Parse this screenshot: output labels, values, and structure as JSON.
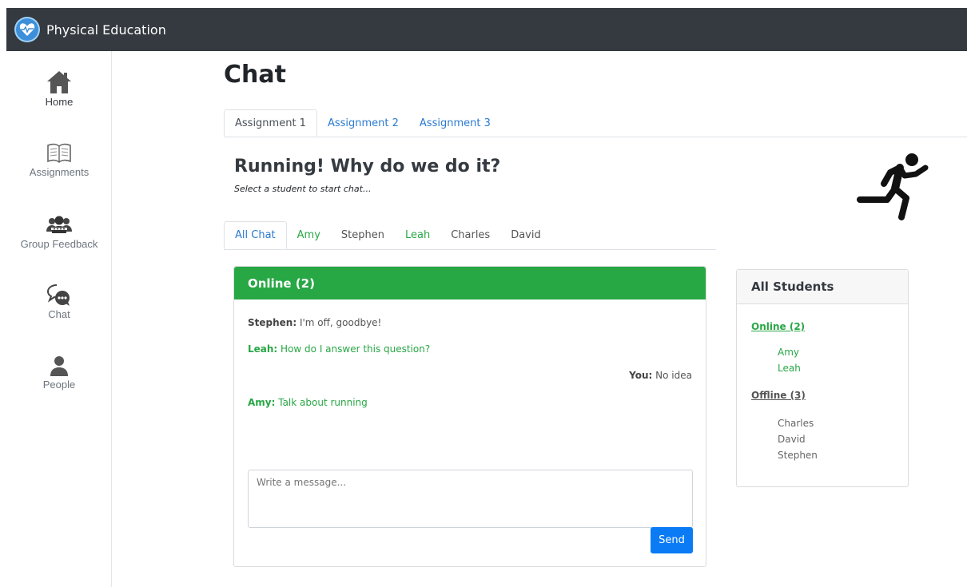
{
  "app": {
    "title": "Physical Education"
  },
  "sidebar": {
    "items": [
      {
        "label": "Home",
        "icon": "home-icon"
      },
      {
        "label": "Assignments",
        "icon": "book-icon"
      },
      {
        "label": "Group Feedback",
        "icon": "group-icon"
      },
      {
        "label": "Chat",
        "icon": "chat-icon"
      },
      {
        "label": "People",
        "icon": "person-icon"
      }
    ]
  },
  "page": {
    "title": "Chat",
    "assignment_tabs": [
      "Assignment 1",
      "Assignment 2",
      "Assignment 3"
    ],
    "active_assignment": "Assignment 1",
    "section_title": "Running! Why do we do it?",
    "section_subtitle": "Select a student to start chat...",
    "student_tabs": [
      "All Chat",
      "Amy",
      "Stephen",
      "Leah",
      "Charles",
      "David"
    ],
    "active_student_tab": "All Chat"
  },
  "chat": {
    "header": "Online (2)",
    "messages": [
      {
        "sender": "Stephen:",
        "text": " I'm off, goodbye!"
      },
      {
        "sender": "Leah:",
        "text": " How do I answer this question?"
      },
      {
        "sender": "You:",
        "text": " No idea"
      },
      {
        "sender": "Amy:",
        "text": " Talk about running"
      }
    ],
    "input_placeholder": "Write a message...",
    "send_label": "Send"
  },
  "students": {
    "header": "All Students",
    "online_label": "Online (2)",
    "online": [
      "Amy",
      "Leah"
    ],
    "offline_label": "Offline (3)",
    "offline": [
      "Charles",
      "David",
      "Stephen"
    ]
  },
  "colors": {
    "topbar": "#343a40",
    "online_green": "#28a745",
    "link_blue": "#2a7ad0",
    "send_blue": "#0a7bf5"
  }
}
